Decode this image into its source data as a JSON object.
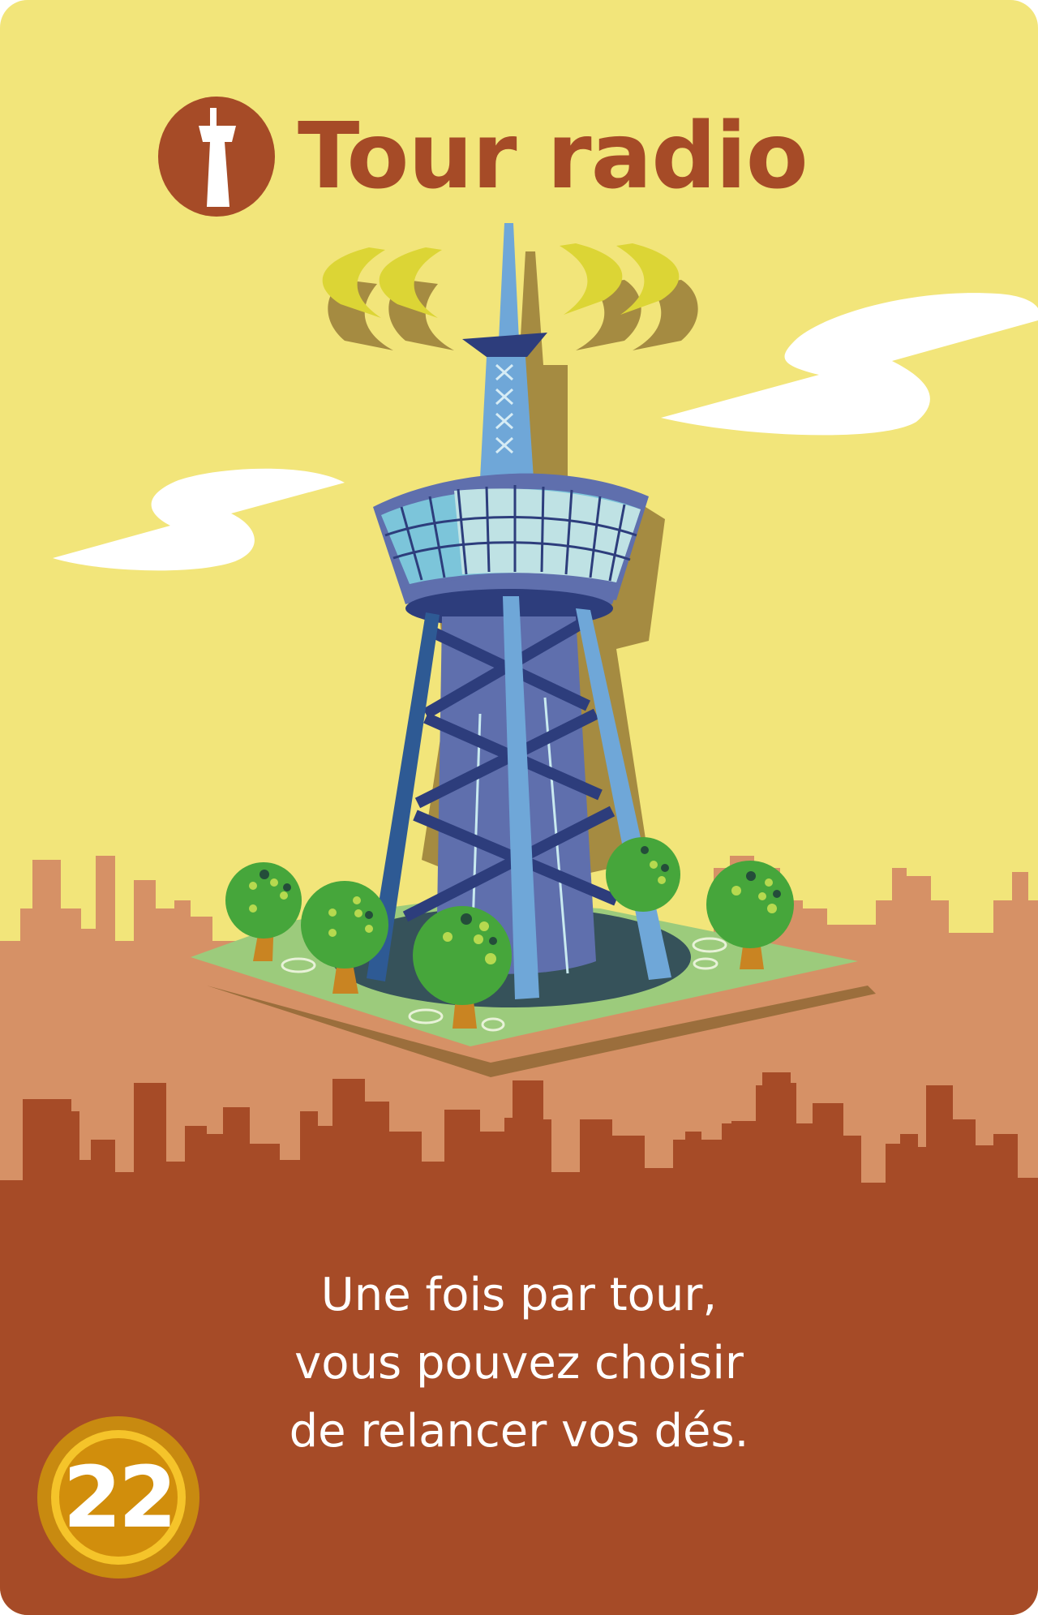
{
  "card": {
    "title": "Tour radio",
    "title_icon": "radio-tower-icon",
    "description_lines": [
      "Une fois par tour,",
      "vous pouvez choisir",
      "de relancer vos dés."
    ],
    "cost": "22"
  },
  "colors": {
    "sky": "#f2e57a",
    "accent_rust": "#a64b27",
    "skyline_back": "#d69166",
    "badge_gold": "#f5c42a",
    "badge_dark_gold": "#c88a10",
    "tower_blue": "#5f6fad",
    "glass": "#7cc5da",
    "grass": "#9ccb7c",
    "tree_green": "#46a63b"
  },
  "illustration": {
    "subject": "radio-tower-illustration",
    "elements": [
      "signal-waves",
      "clouds",
      "city-skyline",
      "trees",
      "grass-plot"
    ]
  }
}
